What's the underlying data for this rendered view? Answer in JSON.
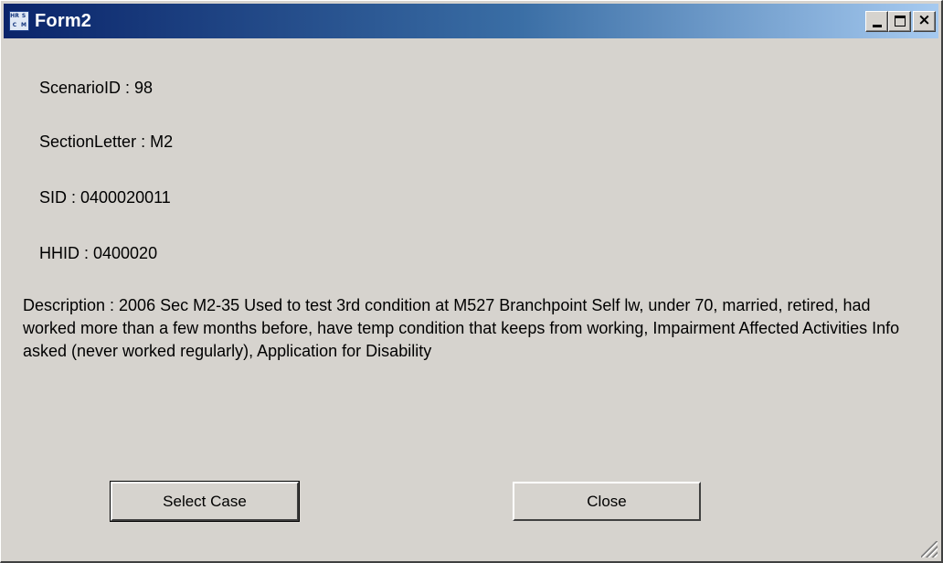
{
  "window": {
    "title": "Form2",
    "icon_name": "app-icon",
    "icon_glyphs": [
      "HR",
      "S",
      "C",
      "M"
    ]
  },
  "fields": {
    "scenario_id": "ScenarioID : 98",
    "section_letter": "SectionLetter : M2",
    "sid": "SID : 0400020011",
    "hhid": "HHID : 0400020"
  },
  "description": "Description : 2006 Sec M2-35 Used to test 3rd condition at M527 Branchpoint Self lw, under 70, married, retired, had worked more than a few months before, have temp condition that keeps from working, Impairment Affected Activities Info asked (never worked regularly), Application for Disability",
  "buttons": {
    "select_case": "Select Case",
    "close": "Close"
  },
  "title_buttons": {
    "minimize_icon": "minimize-icon",
    "maximize_icon": "maximize-icon",
    "close_glyph": "×"
  },
  "colors": {
    "window_bg": "#d6d3ce",
    "titlebar_start": "#0a246a",
    "titlebar_end": "#a6caf0"
  }
}
